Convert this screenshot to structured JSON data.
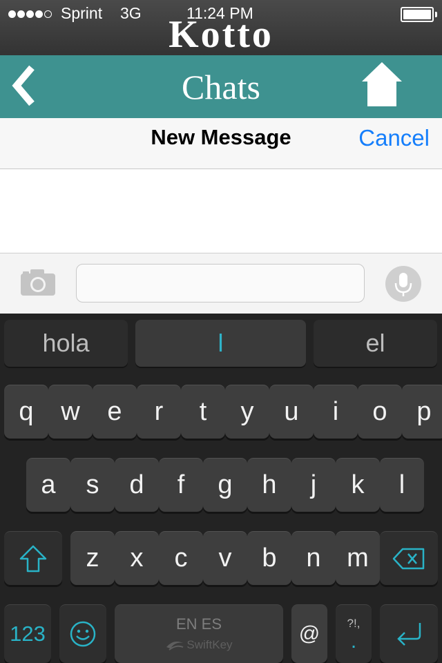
{
  "status_bar": {
    "carrier": "Sprint",
    "network": "3G",
    "time": "11:24 PM"
  },
  "app": {
    "logo": "Kotto"
  },
  "nav": {
    "title": "Chats",
    "back_icon": "chevron-left-icon",
    "home_icon": "home-icon"
  },
  "header": {
    "title": "New Message",
    "cancel_label": "Cancel"
  },
  "compose": {
    "message_value": "",
    "camera_icon": "camera-icon",
    "mic_icon": "microphone-icon"
  },
  "keyboard": {
    "suggestions": [
      "hola",
      "l",
      "el"
    ],
    "row1": [
      "q",
      "w",
      "e",
      "r",
      "t",
      "y",
      "u",
      "i",
      "o",
      "p"
    ],
    "row2": [
      "a",
      "s",
      "d",
      "f",
      "g",
      "h",
      "j",
      "k",
      "l"
    ],
    "row3": [
      "z",
      "x",
      "c",
      "v",
      "b",
      "n",
      "m"
    ],
    "numbers_label": "123",
    "space_label": "EN ES",
    "space_brand": "SwiftKey",
    "at_label": "@",
    "punct_top": "?!,",
    "punct_bottom": "."
  },
  "colors": {
    "teal_nav": "#3e9290",
    "accent_blue": "#157efb",
    "key_accent": "#29b3c7"
  }
}
